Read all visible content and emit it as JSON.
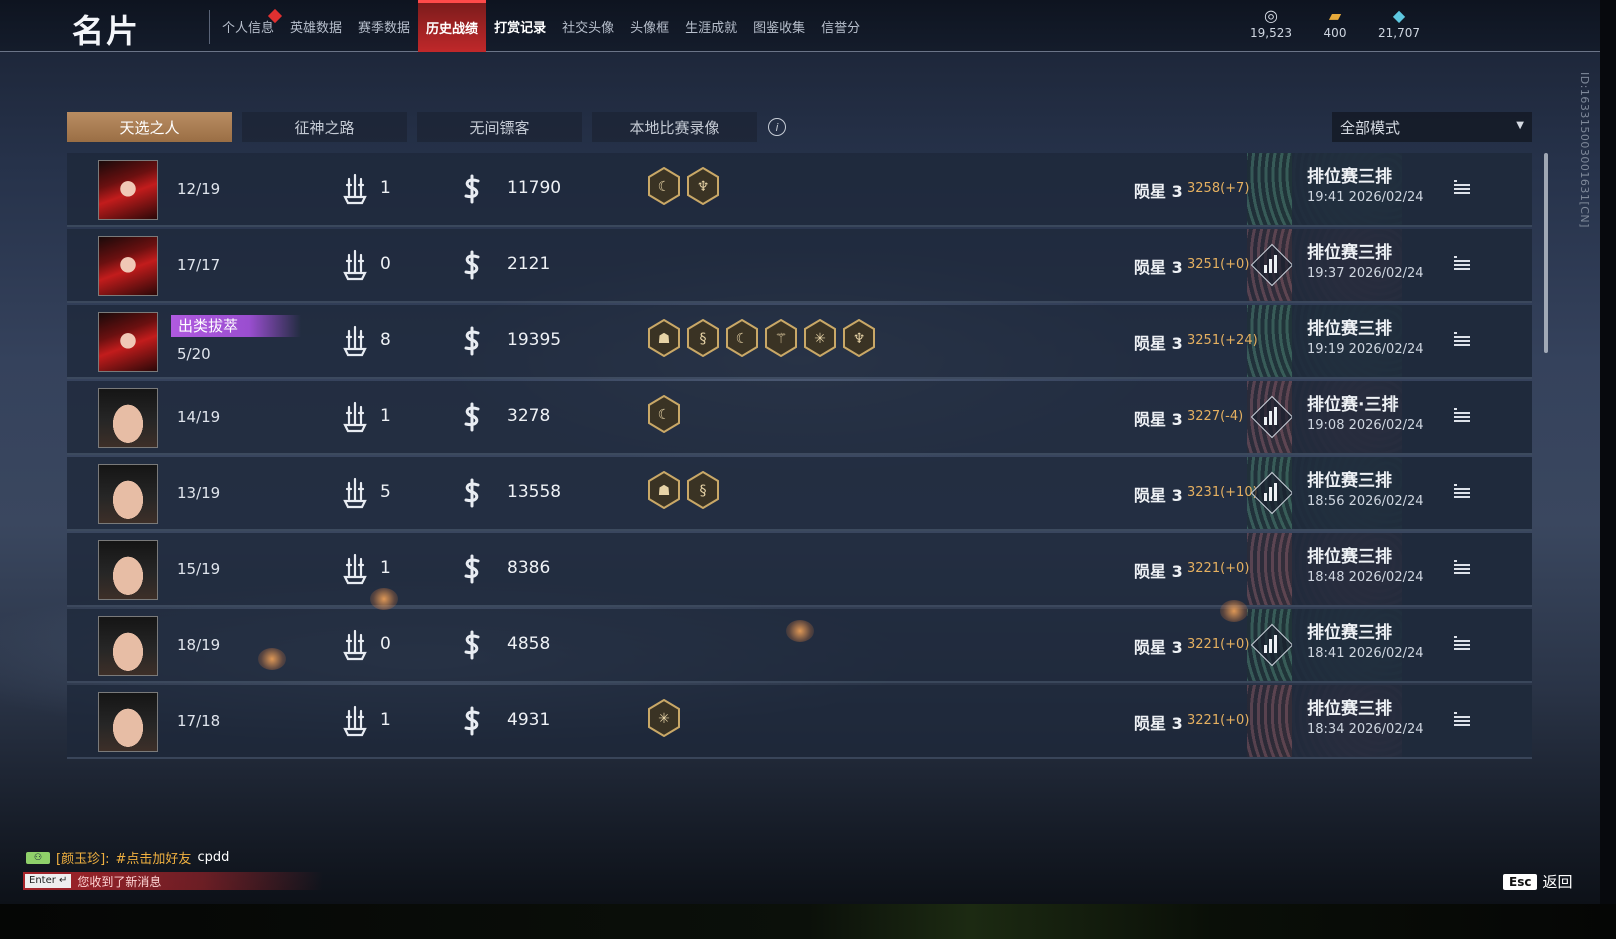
{
  "header": {
    "title": "名片",
    "nav_tabs": [
      {
        "label": "个人信息",
        "active": false,
        "badge": true
      },
      {
        "label": "英雄数据",
        "active": false
      },
      {
        "label": "赛季数据",
        "active": false
      },
      {
        "label": "历史战绩",
        "active": true
      },
      {
        "label": "打赏记录",
        "active": false
      },
      {
        "label": "社交头像",
        "active": false
      },
      {
        "label": "头像框",
        "active": false
      },
      {
        "label": "生涯成就",
        "active": false
      },
      {
        "label": "图鉴收集",
        "active": false
      },
      {
        "label": "信誉分",
        "active": false
      }
    ],
    "currencies": [
      {
        "icon": "coin-stack-icon",
        "value": "19,523"
      },
      {
        "icon": "ticket-icon",
        "value": "400"
      },
      {
        "icon": "gem-icon",
        "value": "21,707"
      }
    ],
    "side_id": "ID:163315003001631[CN]"
  },
  "mode_tabs": [
    "天选之人",
    "征神之路",
    "无间镖客",
    "本地比赛录像"
  ],
  "active_mode_tab": 0,
  "mode_filter": {
    "selected": "全部模式"
  },
  "matches": [
    {
      "avatar": "mask",
      "placement": "12/19",
      "kills": "1",
      "damage": "11790",
      "badges": [
        "crescent-badge-icon",
        "wings-badge-icon"
      ],
      "rank": "陨星 3",
      "points": "3258(+7)",
      "mode": "排位赛三排",
      "time": "19:41  2026/02/24",
      "stats_icon": false
    },
    {
      "avatar": "mask",
      "placement": "17/17",
      "kills": "0",
      "damage": "2121",
      "badges": [],
      "rank": "陨星 3",
      "points": "3251(+0)",
      "mode": "排位赛三排",
      "time": "19:37  2026/02/24",
      "stats_icon": true
    },
    {
      "avatar": "mask",
      "placement": "5/20",
      "tag": "出类拔萃",
      "kills": "8",
      "damage": "19395",
      "badges": [
        "demon-badge-icon",
        "dragon-badge-icon",
        "crescent-badge-icon",
        "trident-badge-icon",
        "cross-badge-icon",
        "wings-badge-icon"
      ],
      "rank": "陨星 3",
      "points": "3251(+24)",
      "mode": "排位赛三排",
      "time": "19:19  2026/02/24",
      "stats_icon": false
    },
    {
      "avatar": "hair",
      "placement": "14/19",
      "kills": "1",
      "damage": "3278",
      "badges": [
        "crescent-badge-icon"
      ],
      "rank": "陨星 3",
      "points": "3227(-4)",
      "mode": "排位赛·三排",
      "time": "19:08  2026/02/24",
      "stats_icon": true
    },
    {
      "avatar": "hair",
      "placement": "13/19",
      "kills": "5",
      "damage": "13558",
      "badges": [
        "demon-badge-icon",
        "dragon-badge-icon"
      ],
      "rank": "陨星 3",
      "points": "3231(+10)",
      "mode": "排位赛三排",
      "time": "18:56  2026/02/24",
      "stats_icon": true
    },
    {
      "avatar": "hair",
      "placement": "15/19",
      "kills": "1",
      "damage": "8386",
      "badges": [],
      "rank": "陨星 3",
      "points": "3221(+0)",
      "mode": "排位赛三排",
      "time": "18:48  2026/02/24",
      "stats_icon": false
    },
    {
      "avatar": "hair",
      "placement": "18/19",
      "kills": "0",
      "damage": "4858",
      "badges": [],
      "rank": "陨星 3",
      "points": "3221(+0)",
      "mode": "排位赛三排",
      "time": "18:41  2026/02/24",
      "stats_icon": true
    },
    {
      "avatar": "hair",
      "placement": "17/18",
      "kills": "1",
      "damage": "4931",
      "badges": [
        "cross-badge-icon"
      ],
      "rank": "陨星 3",
      "points": "3221(+0)",
      "mode": "排位赛三排",
      "time": "18:34  2026/02/24",
      "stats_icon": false
    }
  ],
  "chat": {
    "channel": "⚇",
    "sender": "[颜玉珍]:",
    "message": "#点击加好友",
    "code": "cpdd",
    "enter_key": "Enter ↵",
    "notice": "您收到了新消息"
  },
  "footer": {
    "esc_key": "Esc",
    "back_label": "返回"
  },
  "colors": {
    "accent_red": "#c0282a",
    "active_tab": "#b98d62",
    "points": "#e5b060",
    "highlight_tag": "#b05ae0"
  }
}
